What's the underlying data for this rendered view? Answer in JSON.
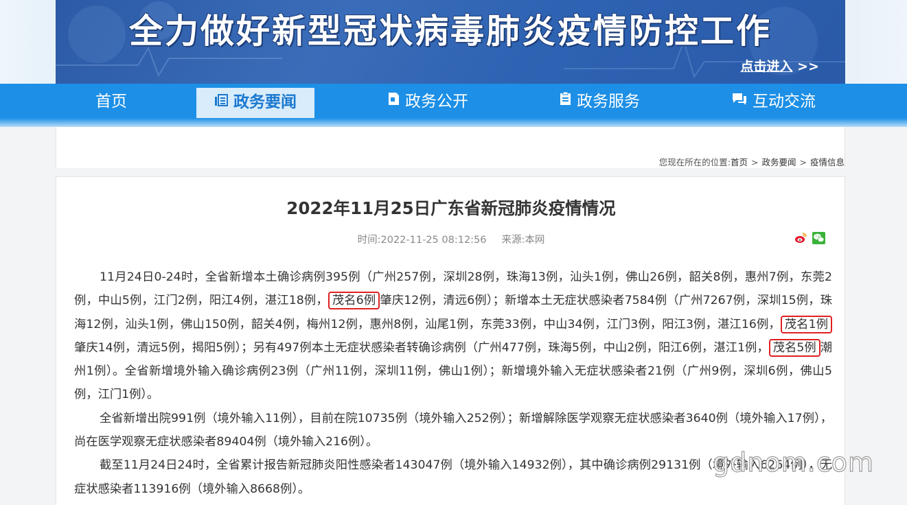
{
  "banner": {
    "title": "全力做好新型冠状病毒肺炎疫情防控工作",
    "enter_link": "点击进入",
    "enter_arrows": ">>"
  },
  "nav": {
    "items": [
      {
        "label": "首页",
        "icon": "none"
      },
      {
        "label": "政务要闻",
        "icon": "news-icon",
        "active": true
      },
      {
        "label": "政务公开",
        "icon": "document-icon"
      },
      {
        "label": "政务服务",
        "icon": "clipboard-icon"
      },
      {
        "label": "互动交流",
        "icon": "chat-icon"
      }
    ]
  },
  "breadcrumb": {
    "prefix": "您现在所在的位置:",
    "items": [
      "首页",
      "政务要闻",
      "疫情信息"
    ],
    "separator": ">"
  },
  "article": {
    "title": "2022年11月25日广东省新冠肺炎疫情情况",
    "time_label": "时间:",
    "time_value": "2022-11-25 08:12:56",
    "source_label": "来源:",
    "source_value": "本网",
    "share": [
      "weibo-icon",
      "wechat-icon"
    ],
    "p1": {
      "s1": "11月24日0-24时，全省新增本土确诊病例395例（广州257例，深圳28例，珠海13例，汕头1例，佛山26例，韶关8例，惠州7例，东莞2例，中山5例，江门2例，阳江4例，湛江18例，",
      "h1": "茂名6例",
      "s2": "肇庆12例，清远6例）；新增本土无症状感染者7584例（广州7267例，深圳15例，珠海12例，汕头1例，佛山150例，韶关4例，梅州12例，惠州8例，汕尾1例，东莞33例，中山34例，江门3例，阳江3例，湛江16例，",
      "h2": "茂名1例",
      "s3": "肇庆14例，清远5例，揭阳5例）；另有497例本土无症状感染者转确诊病例（广州477例，珠海5例，中山2例，阳江6例，湛江1例，",
      "h3": "茂名5例",
      "s4": "潮州1例）。全省新增境外输入确诊病例23例（广州11例，深圳11例，佛山1例）；新增境外输入无症状感染者21例（广州9例，深圳6例，佛山5例，江门1例）。"
    },
    "p2": "全省新增出院991例（境外输入11例），目前在院10735例（境外输入252例）；新增解除医学观察无症状感染者3640例（境外输入17例），尚在医学观察无症状感染者89404例（境外输入216例）。",
    "p3": "截至11月24日24时，全省累计报告新冠肺炎阳性感染者143047例（境外输入14932例），其中确诊病例29131例（境外输入6264例），无症状感染者113916例（境外输入8668例）。"
  },
  "watermark": "gdnom.com",
  "colors": {
    "nav_bg": "#1d8fe6",
    "nav_active_bg": "#d8ecfb",
    "highlight_box": "#e02020",
    "banner_bg": "#2e63b3"
  }
}
